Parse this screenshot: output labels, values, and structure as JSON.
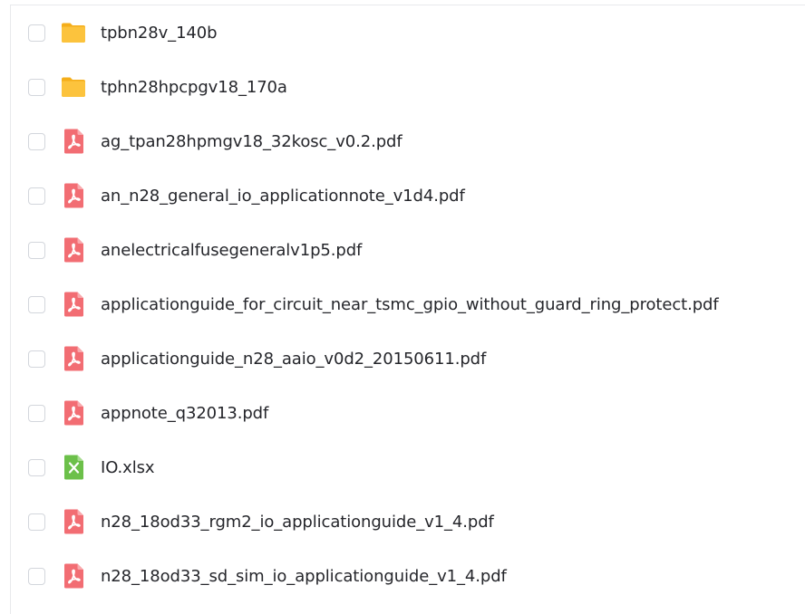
{
  "files": [
    {
      "name": "tpbn28v_140b",
      "type": "folder"
    },
    {
      "name": "tphn28hpcpgv18_170a",
      "type": "folder"
    },
    {
      "name": "ag_tpan28hpmgv18_32kosc_v0.2.pdf",
      "type": "pdf"
    },
    {
      "name": "an_n28_general_io_applicationnote_v1d4.pdf",
      "type": "pdf"
    },
    {
      "name": "anelectricalfusegeneralv1p5.pdf",
      "type": "pdf"
    },
    {
      "name": "applicationguide_for_circuit_near_tsmc_gpio_without_guard_ring_protect.pdf",
      "type": "pdf"
    },
    {
      "name": "applicationguide_n28_aaio_v0d2_20150611.pdf",
      "type": "pdf"
    },
    {
      "name": "appnote_q32013.pdf",
      "type": "pdf"
    },
    {
      "name": "IO.xlsx",
      "type": "excel"
    },
    {
      "name": "n28_18od33_rgm2_io_applicationguide_v1_4.pdf",
      "type": "pdf"
    },
    {
      "name": "n28_18od33_sd_sim_io_applicationguide_v1_4.pdf",
      "type": "pdf"
    }
  ],
  "icons": {
    "folder": "folder-icon",
    "pdf": "pdf-file-icon",
    "excel": "excel-file-icon"
  },
  "colors": {
    "folder": "#fcc33d",
    "pdf": "#f26d73",
    "excel": "#6cc04a",
    "text": "#25262b",
    "checkbox_border": "#d3d6dc"
  }
}
